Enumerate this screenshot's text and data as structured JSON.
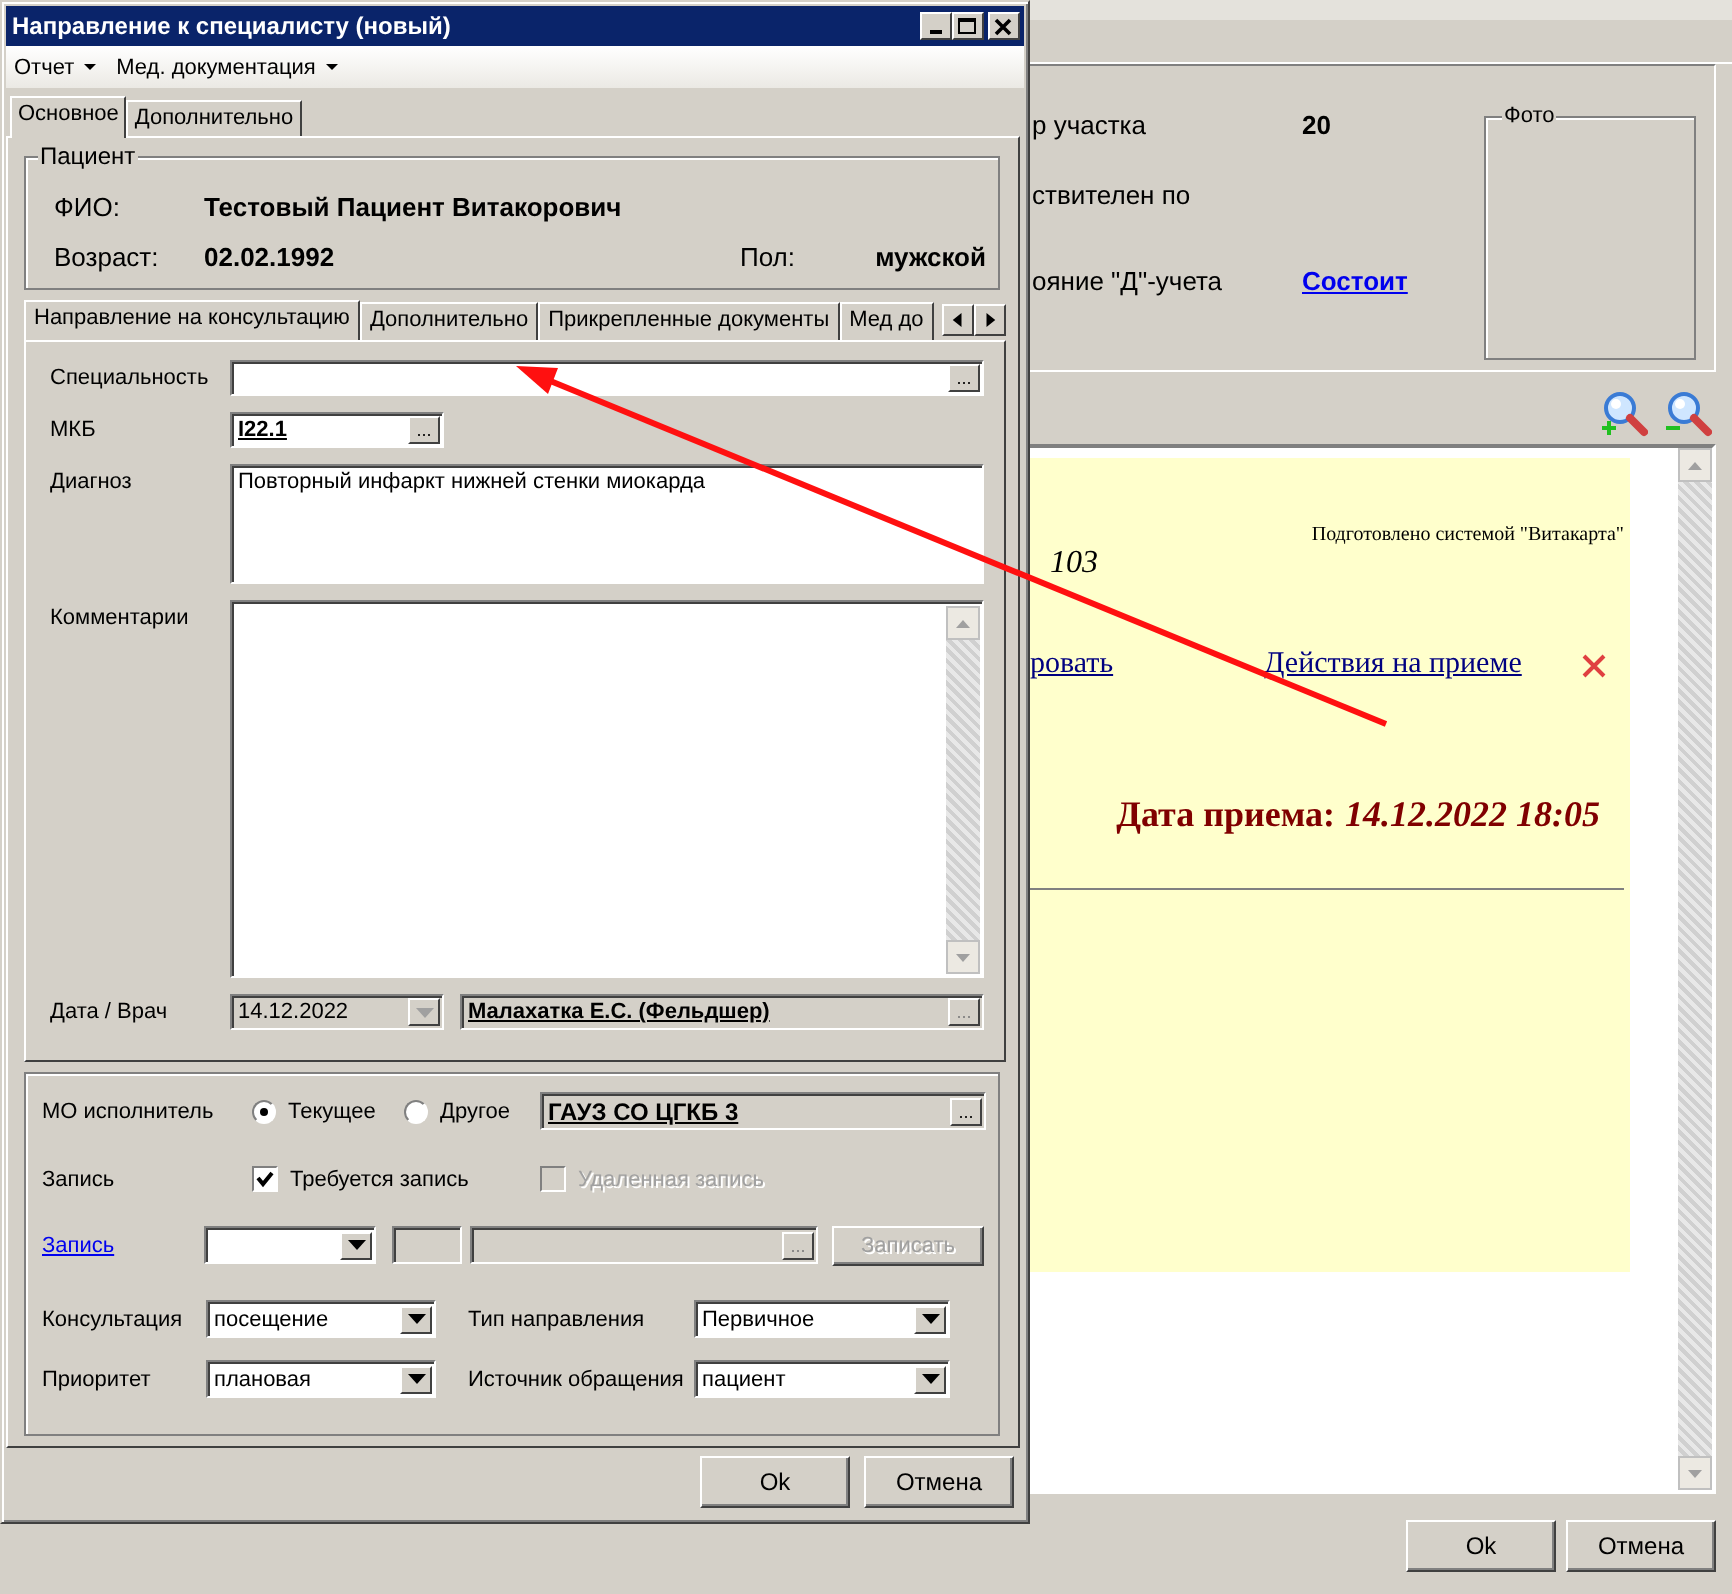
{
  "main_window": {
    "fields": [
      {
        "label": "р участка",
        "value": "20",
        "kind": "bold"
      },
      {
        "label": "ствителен по"
      },
      {
        "label": "ояние \"Д\"-учета",
        "value": "Состоит",
        "kind": "link"
      }
    ],
    "photo": {
      "title": "Фото"
    },
    "document": {
      "note": "Подготовлено системой \"Витакарта\"",
      "number": "103",
      "links": [
        "ровать",
        "Действия на приеме "
      ],
      "date_label": "Дата приема:",
      "date_value": "14.12.2022 18:05"
    },
    "buttons": [
      {
        "label": "Ok"
      },
      {
        "label": "Отмена"
      }
    ]
  },
  "dialog": {
    "title": "Направление к специалисту (новый)",
    "menu": [
      {
        "label": "Отчет"
      },
      {
        "label": "Мед. документация"
      }
    ],
    "tabs": [
      {
        "label": "Основное",
        "selected": true
      },
      {
        "label": "Дополнительно",
        "selected": false
      }
    ],
    "patient": {
      "title": "Пациент",
      "name_label": "ФИО:",
      "name": "Тестовый Пациент Витакорович",
      "age_label": "Возраст:",
      "age": "02.02.1992",
      "sex_label": "Пол:",
      "sex": "мужской"
    },
    "inner_tabs": [
      {
        "label": "Направление на консультацию",
        "selected": true
      },
      {
        "label": "Дополнительно",
        "selected": false
      },
      {
        "label": "Прикрепленные документы",
        "selected": false
      },
      {
        "label": "Мед до",
        "selected": false
      }
    ],
    "referral": {
      "specialty": {
        "label": "Специальность",
        "button": "..."
      },
      "mkb": {
        "label": "МКБ",
        "value": "I22.1",
        "button": "..."
      },
      "diagnosis": {
        "label": "Диагноз",
        "value": "Повторный инфаркт нижней стенки миокарда"
      },
      "comments": {
        "label": "Комментарии"
      },
      "date_doctor": {
        "label": "Дата / Врач",
        "date": "14.12.2022",
        "doctor": "Малахатка Е.С. (Фельдшер)",
        "button": "..."
      }
    },
    "executor": {
      "label": "МО исполнитель",
      "options": [
        {
          "label": "Текущее",
          "selected": true
        },
        {
          "label": "Другое",
          "selected": false
        }
      ],
      "value": "ГАУЗ СО ЦГКБ 3",
      "button": "..."
    },
    "record": {
      "label": "Запись",
      "options": [
        {
          "label": "Требуется запись",
          "checked": true,
          "disabled": false
        },
        {
          "label": "Удаленная запись",
          "checked": false,
          "disabled": true
        }
      ]
    },
    "booking": {
      "link": "Запись",
      "button": "...",
      "action": {
        "label": "Записать",
        "disabled": true
      }
    },
    "combos": [
      {
        "label": "Консультация",
        "value": "посещение"
      },
      {
        "label": "Тип направления",
        "value": "Первичное"
      },
      {
        "label": "Приоритет",
        "value": "плановая"
      },
      {
        "label": "Источник обращения",
        "value": "пациент"
      }
    ],
    "buttons": [
      {
        "label": "Ok"
      },
      {
        "label": "Отмена"
      }
    ]
  }
}
